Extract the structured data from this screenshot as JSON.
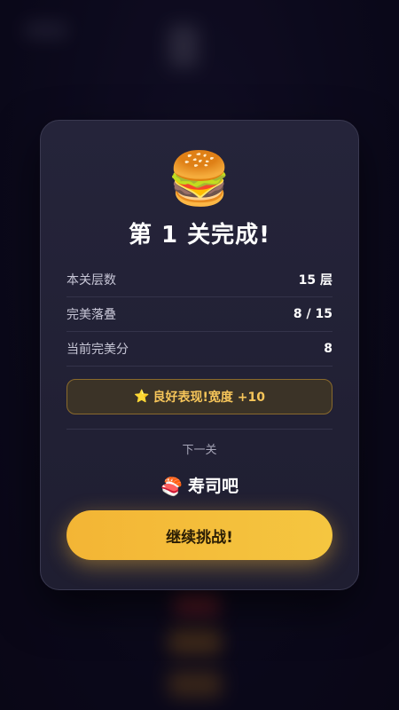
{
  "result": {
    "icon": "burger-icon",
    "icon_glyph": "🍔",
    "title": "第 1 关完成!"
  },
  "stats": [
    {
      "label": "本关层数",
      "value": "15 层"
    },
    {
      "label": "完美落叠",
      "value": "8 / 15"
    },
    {
      "label": "当前完美分",
      "value": "8"
    }
  ],
  "badge": {
    "icon": "star-icon",
    "icon_glyph": "⭐",
    "text": "良好表现!宽度 +10"
  },
  "next": {
    "label": "下一关",
    "icon": "sushi-icon",
    "icon_glyph": "🍣",
    "name": "寿司吧"
  },
  "actions": {
    "continue_label": "继续挑战!"
  },
  "colors": {
    "accent": "#f3b535",
    "badge_text": "#f6c55a",
    "card_bg": "#25243a",
    "page_bg": "#0d0b1f"
  }
}
